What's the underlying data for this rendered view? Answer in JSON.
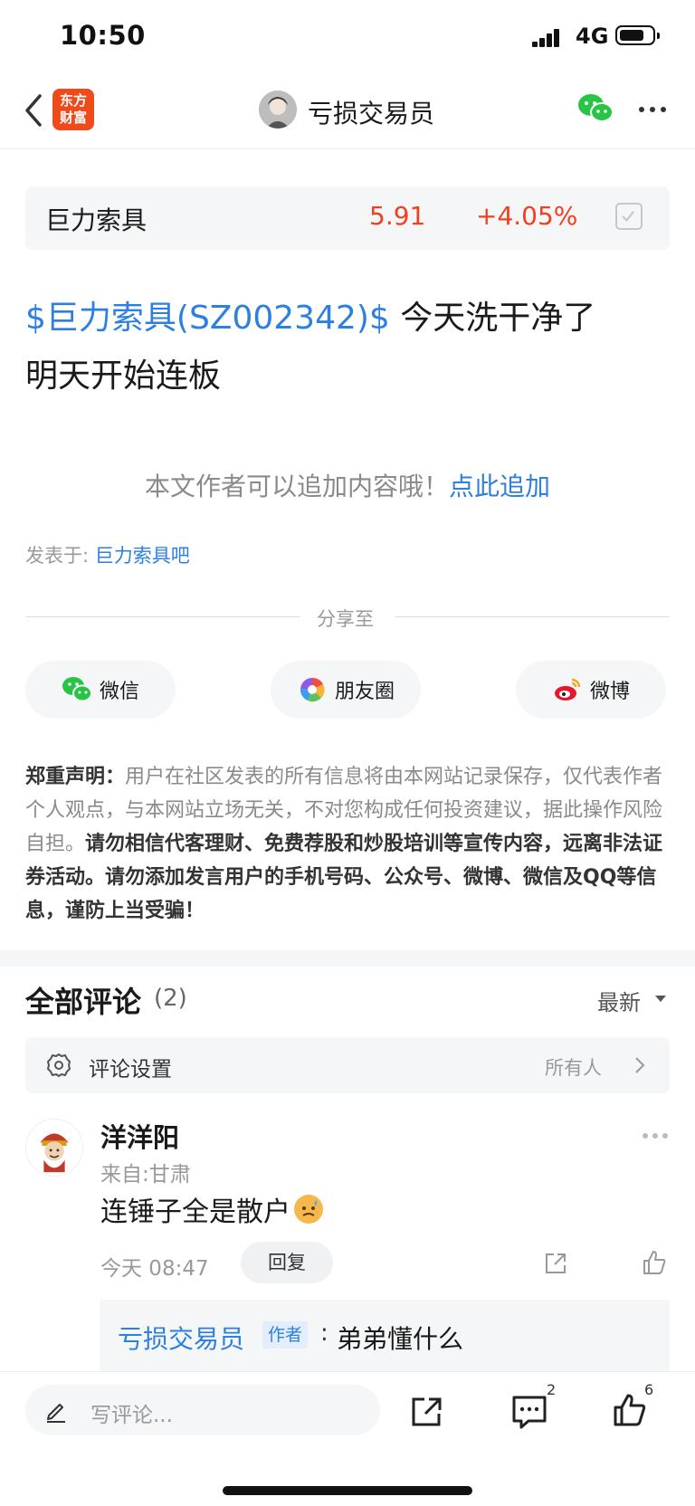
{
  "status_bar": {
    "time": "10:50",
    "network": "4G"
  },
  "nav": {
    "logo_text_line1": "东方",
    "logo_text_line2": "财富",
    "title": "亏损交易员"
  },
  "stock_card": {
    "name": "巨力索具",
    "price": "5.91",
    "change": "+4.05%"
  },
  "post": {
    "tag": "$巨力索具(SZ002342)$",
    "text_line1": " 今天洗干净了",
    "text_line2": " 明天开始连板"
  },
  "append": {
    "prompt": "本文作者可以追加内容哦！",
    "link": "点此追加"
  },
  "posted_in": {
    "label": "发表于: ",
    "forum": "巨力索具吧"
  },
  "share": {
    "label": "分享至",
    "wechat": "微信",
    "moments": "朋友圈",
    "weibo": "微博"
  },
  "disclaimer": {
    "title": "郑重声明：",
    "normal": "用户在社区发表的所有信息将由本网站记录保存，仅代表作者个人观点，与本网站立场无关，不对您构成任何投资建议，据此操作风险自担。",
    "bold": "请勿相信代客理财、免费荐股和炒股培训等宣传内容，远离非法证券活动。请勿添加发言用户的手机号码、公众号、微博、微信及QQ等信息，谨防上当受骗！"
  },
  "comments": {
    "title": "全部评论",
    "count": "(2)",
    "sort": "最新",
    "settings_label": "评论设置",
    "settings_value": "所有人",
    "items": [
      {
        "user": "洋洋阳",
        "location": "来自:甘肃",
        "text": "连锤子全是散户",
        "time": "今天 08:47",
        "reply_label": "回复",
        "reply": {
          "author": "亏损交易员",
          "author_tag": "作者",
          "colon": ":",
          "text": "弟弟懂什么"
        }
      }
    ]
  },
  "bottom_bar": {
    "placeholder": "写评论...",
    "comment_count": "2",
    "like_count": "6"
  },
  "colors": {
    "accent_blue": "#2d7fe0",
    "up_red": "#f0401f",
    "logo_orange": "#f04a1a",
    "wechat_green": "#28c445"
  }
}
